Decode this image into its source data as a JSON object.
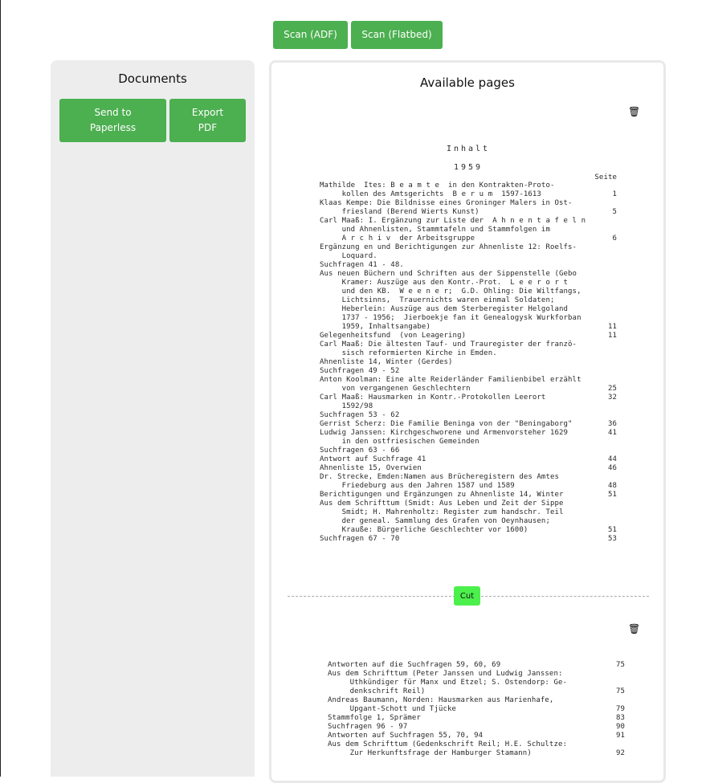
{
  "toolbar": {
    "scan_adf": "Scan (ADF)",
    "scan_flatbed": "Scan (Flatbed)"
  },
  "documents": {
    "title": "Documents",
    "send_label": "Send to Paperless",
    "export_label": "Export PDF"
  },
  "pages_panel": {
    "title": "Available pages",
    "cut_label": "Cut"
  },
  "icons": {
    "trash": "trash-icon"
  },
  "colors": {
    "accent": "#4caf50",
    "cut": "#4cf04c",
    "panel": "#ededee"
  },
  "page1": {
    "heading": "Inhalt",
    "year": "1959",
    "seite": "Seite",
    "rows": [
      {
        "text": "Mathilde  Ites: B e a m t e  in den Kontrakten-Proto-",
        "num": ""
      },
      {
        "text": "     kollen des Amtsgerichts  B e r u m  1597-1613",
        "num": "1"
      },
      {
        "text": "Klaas Kempe: Die Bildnisse eines Groninger Malers in Ost-",
        "num": ""
      },
      {
        "text": "     friesland (Berend Wierts Kunst)",
        "num": "5"
      },
      {
        "text": "Carl Maaß: I. Ergänzung zur Liste der  A h n e n t a f e l n",
        "num": ""
      },
      {
        "text": "     und Ahnenlisten, Stammtafeln und Stammfolgen im",
        "num": ""
      },
      {
        "text": "     A r c h i v  der Arbeitsgruppe",
        "num": "6"
      },
      {
        "text": "Ergänzung en und Berichtigungen zur Ahnenliste 12: Roelfs-",
        "num": ""
      },
      {
        "text": "     Loquard.",
        "num": ""
      },
      {
        "text": "Suchfragen 41 - 48.",
        "num": ""
      },
      {
        "text": "Aus neuen Büchern und Schriften aus der Sippenstelle (Gebo",
        "num": ""
      },
      {
        "text": "     Kramer: Auszüge aus den Kontr.-Prot.  L e e r o r t",
        "num": ""
      },
      {
        "text": "     und den KB.  W e e n e r;  G.D. Ohling: Die Wiltfangs,",
        "num": ""
      },
      {
        "text": "     Lichtsinns,  Trauernichts waren einmal Soldaten;",
        "num": ""
      },
      {
        "text": "     Heberlein: Auszüge aus dem Sterberegister Helgoland",
        "num": ""
      },
      {
        "text": "     1737 - 1956;  Jierboekje fan it Genealogysk Wurkforban",
        "num": ""
      },
      {
        "text": "     1959, Inhaltsangabe)",
        "num": "11"
      },
      {
        "text": "Gelegenheitsfund  (von Leagering)",
        "num": "11"
      },
      {
        "text": "Carl Maaß: Die ältesten Tauf- und Trauregister der franzö-",
        "num": ""
      },
      {
        "text": "     sisch reformierten Kirche in Emden.",
        "num": ""
      },
      {
        "text": "Ahnenliste 14, Winter (Gerdes)",
        "num": ""
      },
      {
        "text": "Suchfragen 49 - 52",
        "num": ""
      },
      {
        "text": "Anton Koolman: Eine alte Reiderländer Familienbibel erzählt",
        "num": ""
      },
      {
        "text": "     von vergangenen Geschlechtern",
        "num": "25"
      },
      {
        "text": "Carl Maaß: Hausmarken in Kontr.-Protokollen Leerort",
        "num": "32"
      },
      {
        "text": "     1592/98",
        "num": ""
      },
      {
        "text": "Suchfragen 53 - 62",
        "num": ""
      },
      {
        "text": "Gerrist Scherz: Die Familie Beninga von der \"Beningaborg\"",
        "num": "36"
      },
      {
        "text": "Ludwig Janssen: Kirchgeschworene und Armenvorsteher 1629",
        "num": "41"
      },
      {
        "text": "     in den ostfriesischen Gemeinden",
        "num": ""
      },
      {
        "text": "Suchfragen 63 - 66",
        "num": ""
      },
      {
        "text": "Antwort auf Suchfrage 41",
        "num": "44"
      },
      {
        "text": "Ahnenliste 15, Overwien",
        "num": "46"
      },
      {
        "text": "Dr. Strecke, Emden:Namen aus Brücheregistern des Amtes",
        "num": ""
      },
      {
        "text": "     Friedeburg aus den Jahren 1587 und 1589",
        "num": "48"
      },
      {
        "text": "Berichtigungen und Ergänzungen zu Ahnenliste 14, Winter",
        "num": "51"
      },
      {
        "text": "Aus dem Schrifttum (Smidt: Aus Leben und Zeit der Sippe",
        "num": ""
      },
      {
        "text": "     Smidt; H. Mahrenholtz: Register zum handschr. Teil",
        "num": ""
      },
      {
        "text": "     der geneal. Sammlung des Grafen von Oeynhausen;",
        "num": ""
      },
      {
        "text": "     Krauße: Bürgerliche Geschlechter vor 1600)",
        "num": "51"
      },
      {
        "text": "Suchfragen 67 - 70",
        "num": "53"
      }
    ]
  },
  "page2": {
    "rows": [
      {
        "text": "Antworten auf die Suchfragen 59, 60, 69",
        "num": "75"
      },
      {
        "text": "Aus dem Schrifttum (Peter Janssen und Ludwig Janssen:",
        "num": ""
      },
      {
        "text": "     Uthkündiger für Manx und Etzel; S. Ostendorp: Ge-",
        "num": ""
      },
      {
        "text": "     denkschrift Reil)",
        "num": "75"
      },
      {
        "text": "Andreas Baumann, Norden: Hausmarken aus Marienhafe,",
        "num": ""
      },
      {
        "text": "     Upgant-Schott und Tjücke",
        "num": "79"
      },
      {
        "text": "Stammfolge 1, Sprämer",
        "num": "83"
      },
      {
        "text": "Suchfragen 96 - 97",
        "num": "90"
      },
      {
        "text": "Antworten auf Suchfragen 55, 70, 94",
        "num": "91"
      },
      {
        "text": "Aus dem Schrifttum (Gedenkschrift Reil; H.E. Schultze:",
        "num": ""
      },
      {
        "text": "     Zur Herkunftsfrage der Hamburger Stamann)",
        "num": "92"
      }
    ]
  }
}
